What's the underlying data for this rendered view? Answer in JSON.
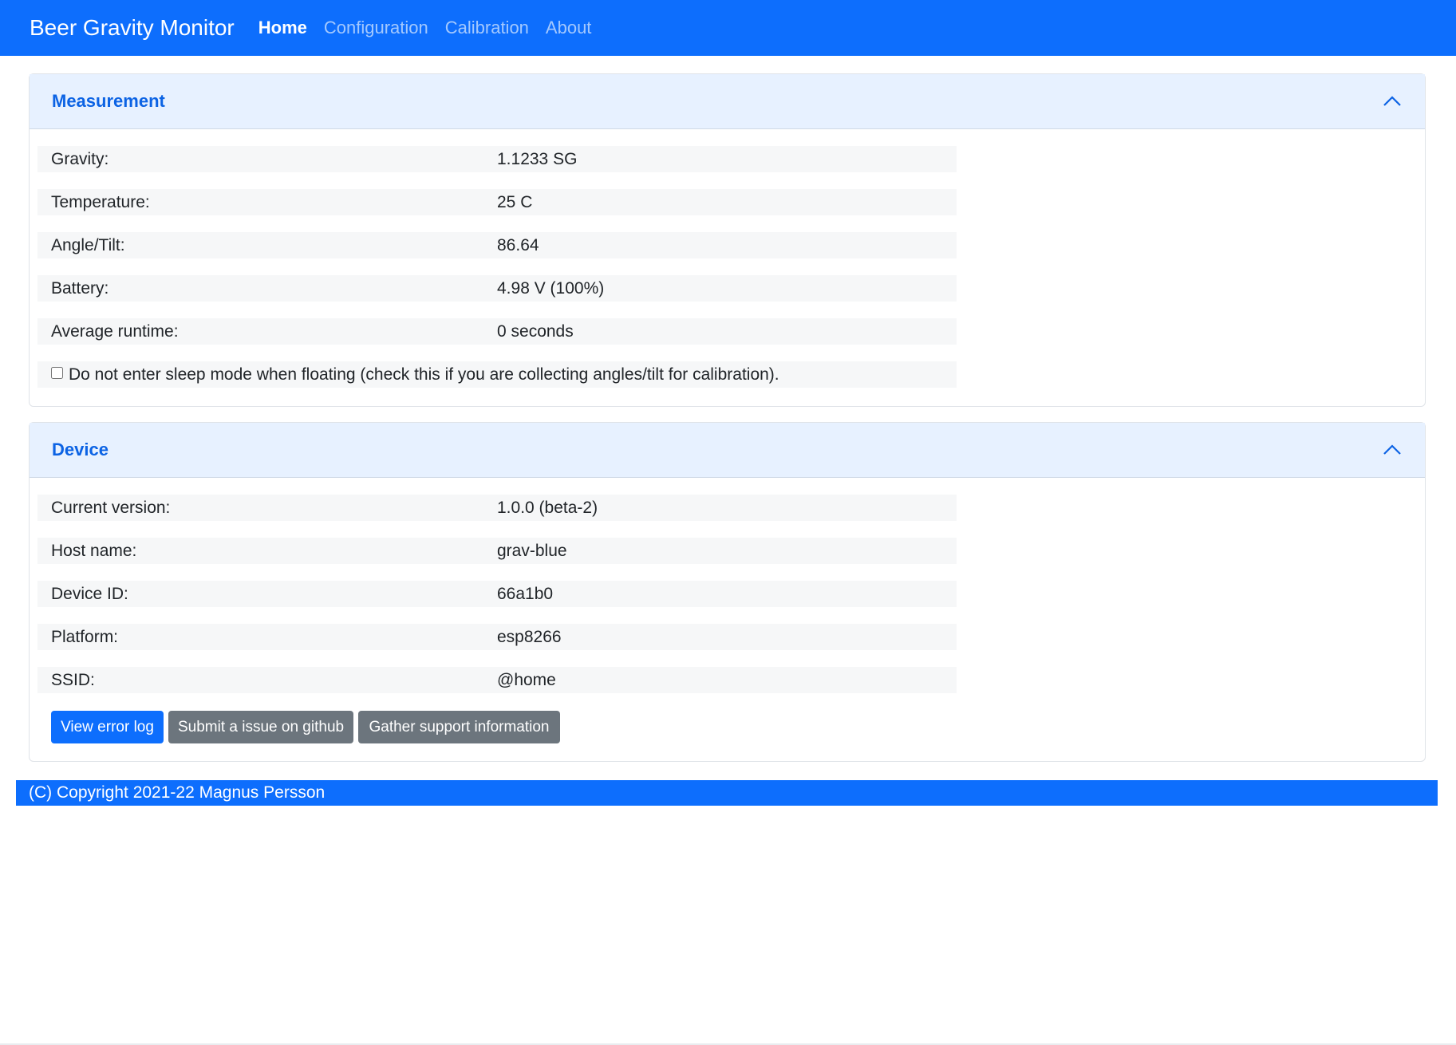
{
  "navbar": {
    "brand": "Beer Gravity Monitor",
    "links": [
      "Home",
      "Configuration",
      "Calibration",
      "About"
    ],
    "active": "Home"
  },
  "measurement": {
    "title": "Measurement",
    "rows": [
      {
        "label": "Gravity:",
        "value": "1.1233 SG"
      },
      {
        "label": "Temperature:",
        "value": "25 C"
      },
      {
        "label": "Angle/Tilt:",
        "value": "86.64"
      },
      {
        "label": "Battery:",
        "value": "4.98 V (100%)"
      },
      {
        "label": "Average runtime:",
        "value": "0 seconds"
      }
    ],
    "sleep_checkbox_label": "Do not enter sleep mode when floating (check this if you are collecting angles/tilt for calibration).",
    "sleep_checked": false
  },
  "device": {
    "title": "Device",
    "rows": [
      {
        "label": "Current version:",
        "value": "1.0.0 (beta-2)"
      },
      {
        "label": "Host name:",
        "value": "grav-blue"
      },
      {
        "label": "Device ID:",
        "value": "66a1b0"
      },
      {
        "label": "Platform:",
        "value": "esp8266"
      },
      {
        "label": "SSID:",
        "value": "@home"
      }
    ],
    "buttons": {
      "error_log": "View error log",
      "github": "Submit a issue on github",
      "support": "Gather support information"
    }
  },
  "footer": {
    "copyright": "(C) Copyright 2021-22 Magnus Persson"
  },
  "colors": {
    "primary": "#0d6efd",
    "secondary": "#6c757d",
    "header_bg": "#e7f1ff",
    "header_text": "#0c63e4"
  },
  "icons": {
    "collapse": "chevron-up-icon"
  }
}
